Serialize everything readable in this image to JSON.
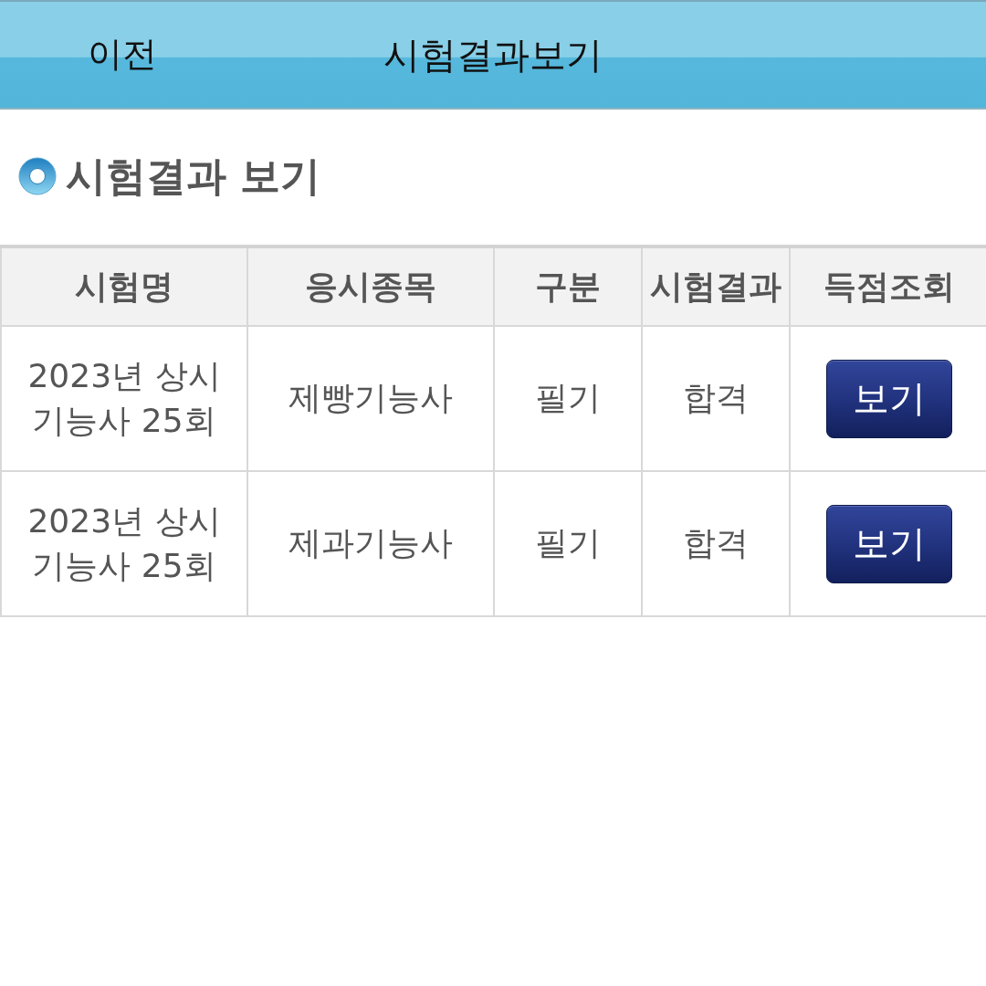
{
  "header": {
    "back_button": "이전",
    "title": "시험결과보기"
  },
  "section": {
    "title": "시험결과 보기"
  },
  "table": {
    "columns": [
      "시험명",
      "응시종목",
      "구분",
      "시험결과",
      "득점조회"
    ],
    "rows": [
      {
        "exam": "2023년 상시 기능사 25회",
        "subject": "제빵기능사",
        "type": "필기",
        "result": "합격",
        "action": "보기"
      },
      {
        "exam": "2023년 상시 기능사 25회",
        "subject": "제과기능사",
        "type": "필기",
        "result": "합격",
        "action": "보기"
      }
    ]
  }
}
